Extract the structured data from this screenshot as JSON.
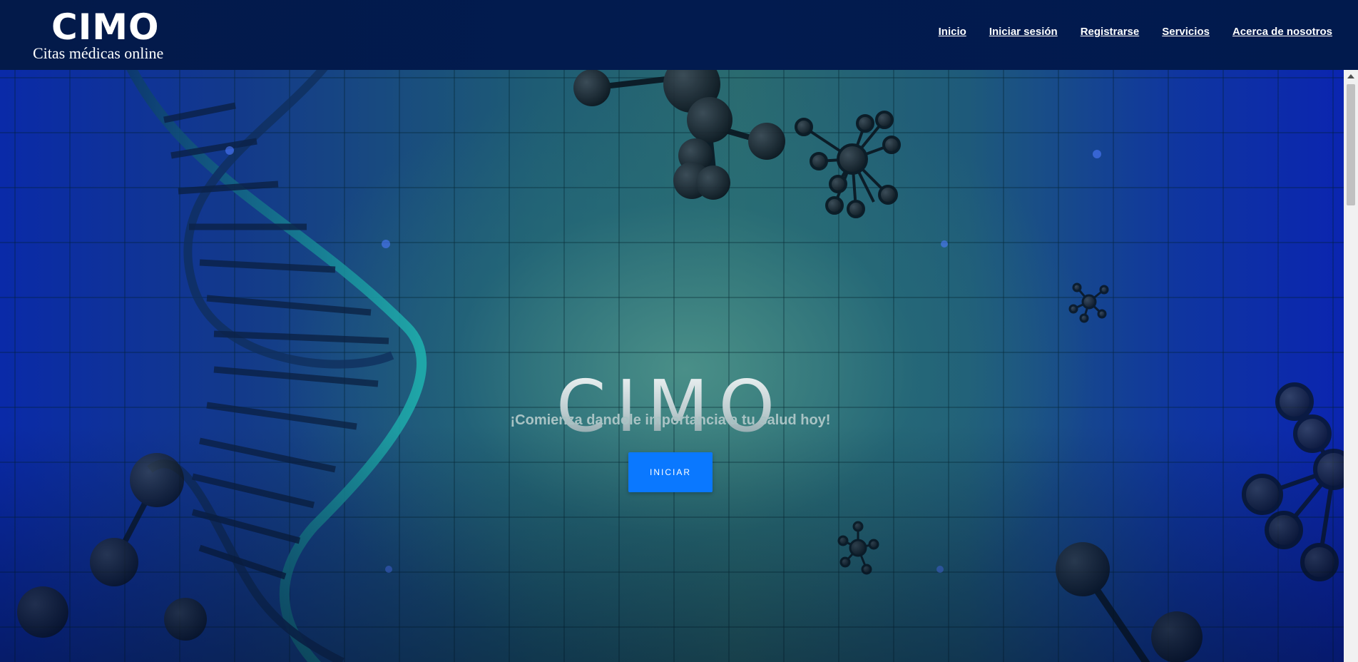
{
  "header": {
    "logo": {
      "mark": "CIMO",
      "tagline": "Citas médicas online"
    },
    "nav": [
      {
        "label": "Inicio"
      },
      {
        "label": "Iniciar sesión"
      },
      {
        "label": "Registrarse"
      },
      {
        "label": "Servicios"
      },
      {
        "label": "Acerca de nosotros"
      }
    ]
  },
  "hero": {
    "title": "CIMO",
    "subtitle": "¡Comienza dandole importancia a tu salud hoy!",
    "button_label": "INICIAR"
  },
  "colors": {
    "header_bg": "#021b4f",
    "button_bg": "#0a78ff",
    "hero_teal": "#2a6b70",
    "hero_blue": "#0b25b0"
  },
  "icons": {
    "scroll_up": "caret-up-icon"
  }
}
